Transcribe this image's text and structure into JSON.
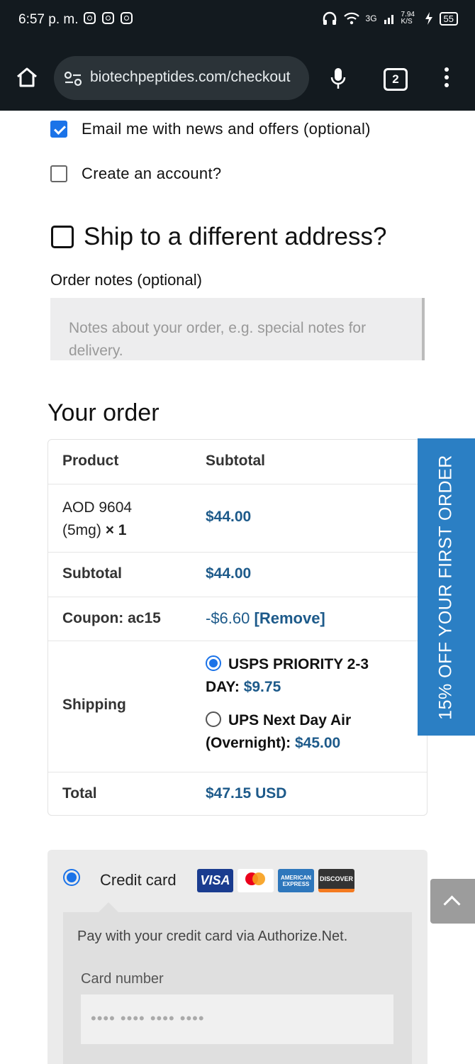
{
  "status_bar": {
    "time": "6:57 p. m.",
    "network": "3G",
    "speed": "7.94 K/S",
    "battery": "55"
  },
  "browser": {
    "url": "biotechpeptides.com/checkout",
    "tab_count": "2"
  },
  "checkout": {
    "email_optin": {
      "label": "Email me with news and offers (optional)",
      "checked": true
    },
    "create_account": {
      "label": "Create an account?",
      "checked": false
    },
    "ship_different": {
      "label": "Ship to a different address?",
      "checked": false
    },
    "order_notes": {
      "label": "Order notes (optional)",
      "placeholder": "Notes about your order, e.g. special notes for delivery."
    }
  },
  "order": {
    "heading": "Your order",
    "header": {
      "product": "Product",
      "subtotal": "Subtotal"
    },
    "item": {
      "name": "AOD 9604 (5mg)",
      "qty": "× 1",
      "price": "$44.00"
    },
    "subtotal": {
      "label": "Subtotal",
      "value": "$44.00"
    },
    "coupon": {
      "label": "Coupon: ac15",
      "amount": "-$6.60",
      "remove": "[Remove]"
    },
    "shipping": {
      "label": "Shipping",
      "options": [
        {
          "name": "USPS PRIORITY 2-3 DAY:",
          "price": "$9.75",
          "selected": true
        },
        {
          "name": "UPS Next Day Air (Overnight):",
          "price": "$45.00",
          "selected": false
        }
      ]
    },
    "total": {
      "label": "Total",
      "value": "$47.15 USD"
    }
  },
  "promo_tab": "15% OFF YOUR FIRST ORDER",
  "payment": {
    "method_label": "Credit card",
    "cards": [
      "VISA",
      "mastercard",
      "AMERICAN EXPRESS",
      "DISCOVER"
    ],
    "description": "Pay with your credit card via Authorize.Net.",
    "card_number_label": "Card number",
    "card_number_placeholder": "•••• •••• •••• ••••"
  },
  "colors": {
    "accent": "#1b73e8",
    "price": "#1d5a8a",
    "promo": "#2b7fc4"
  }
}
